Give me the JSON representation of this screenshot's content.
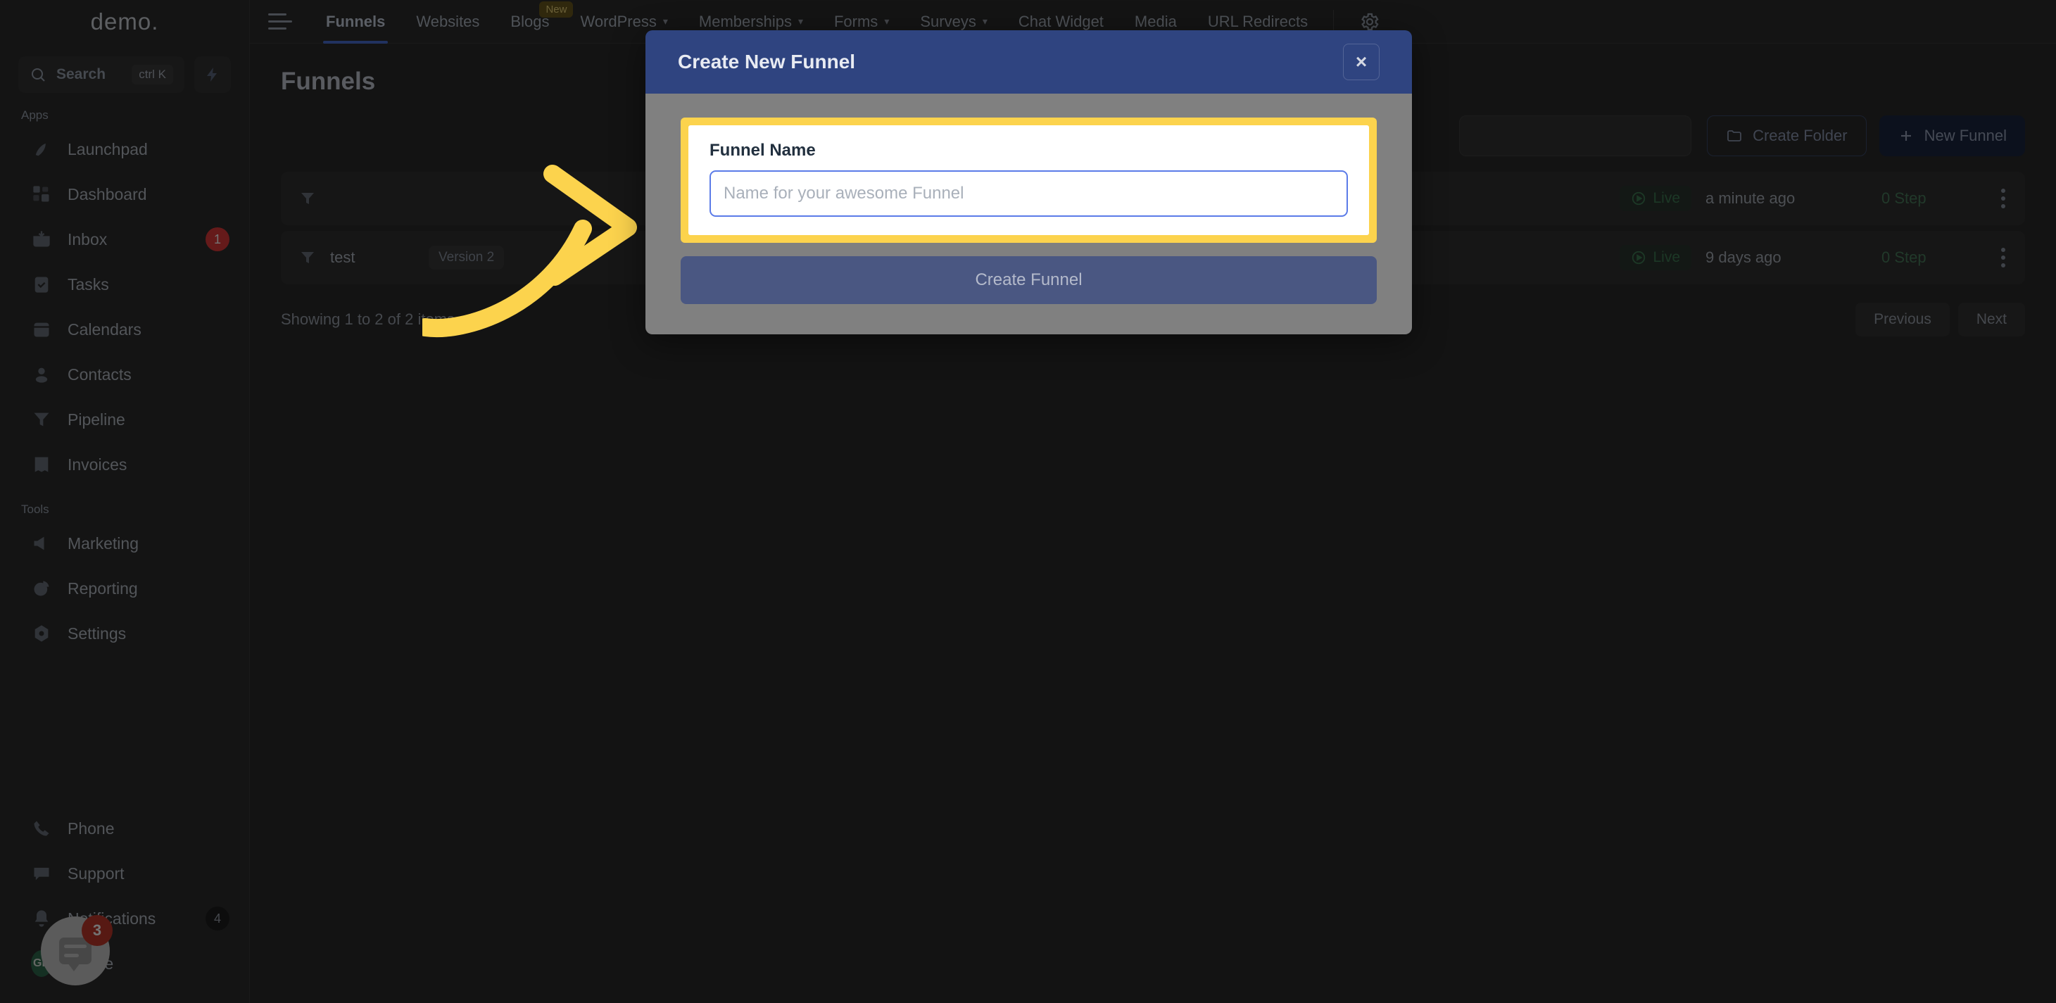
{
  "brand": {
    "logo": "demo."
  },
  "sidebar": {
    "search": {
      "label": "Search",
      "shortcut": "ctrl K"
    },
    "sections": [
      {
        "label": "Apps",
        "items": [
          {
            "label": "Launchpad",
            "icon": "rocket-icon",
            "badge": ""
          },
          {
            "label": "Dashboard",
            "icon": "grid-icon",
            "badge": ""
          },
          {
            "label": "Inbox",
            "icon": "inbox-icon",
            "badge": "1"
          },
          {
            "label": "Tasks",
            "icon": "clipboard-check-icon",
            "badge": ""
          },
          {
            "label": "Calendars",
            "icon": "calendar-icon",
            "badge": ""
          },
          {
            "label": "Contacts",
            "icon": "user-icon",
            "badge": ""
          },
          {
            "label": "Pipeline",
            "icon": "funnel-icon",
            "badge": ""
          },
          {
            "label": "Invoices",
            "icon": "invoice-icon",
            "badge": ""
          }
        ]
      },
      {
        "label": "Tools",
        "items": [
          {
            "label": "Marketing",
            "icon": "megaphone-icon",
            "badge": ""
          },
          {
            "label": "Reporting",
            "icon": "pie-chart-icon",
            "badge": ""
          },
          {
            "label": "Settings",
            "icon": "gear-icon",
            "badge": ""
          }
        ]
      }
    ],
    "bottom_items": [
      {
        "label": "Phone",
        "icon": "phone-icon",
        "badge": ""
      },
      {
        "label": "Support",
        "icon": "chat-icon",
        "badge": ""
      },
      {
        "label": "Notifications",
        "icon": "bell-icon",
        "badge": "4"
      },
      {
        "label": "Profile",
        "icon": "avatar-icon",
        "badge": "",
        "avatar": "GR"
      }
    ]
  },
  "topnav": {
    "items": [
      {
        "label": "Funnels",
        "active": true,
        "caret": false,
        "badge": ""
      },
      {
        "label": "Websites",
        "active": false,
        "caret": false,
        "badge": ""
      },
      {
        "label": "Blogs",
        "active": false,
        "caret": false,
        "badge": "New"
      },
      {
        "label": "WordPress",
        "active": false,
        "caret": true,
        "badge": ""
      },
      {
        "label": "Memberships",
        "active": false,
        "caret": true,
        "badge": ""
      },
      {
        "label": "Forms",
        "active": false,
        "caret": true,
        "badge": ""
      },
      {
        "label": "Surveys",
        "active": false,
        "caret": true,
        "badge": ""
      },
      {
        "label": "Chat Widget",
        "active": false,
        "caret": false,
        "badge": ""
      },
      {
        "label": "Media",
        "active": false,
        "caret": false,
        "badge": ""
      },
      {
        "label": "URL Redirects",
        "active": false,
        "caret": false,
        "badge": ""
      }
    ],
    "settings_icon": "gear-icon"
  },
  "main": {
    "title": "Funnels",
    "toolbar": {
      "filter_placeholder": "",
      "create_folder_label": "Create Folder",
      "new_funnel_label": "New Funnel"
    },
    "rows": [
      {
        "name": "",
        "version": "",
        "status": "Live",
        "updated": "a minute ago",
        "steps": "0 Step"
      },
      {
        "name": "test",
        "version": "Version 2",
        "status": "Live",
        "updated": "9 days ago",
        "steps": "0 Step"
      }
    ],
    "showing": "Showing 1 to 2 of 2 items",
    "pagination": {
      "previous": "Previous",
      "next": "Next"
    }
  },
  "chat_widget": {
    "badge": "3"
  },
  "modal": {
    "title": "Create New Funnel",
    "close_label": "×",
    "field_label": "Funnel Name",
    "field_value": "",
    "field_placeholder": "Name for your awesome Funnel",
    "submit_label": "Create Funnel"
  },
  "colors": {
    "modal_header": "#2f4480",
    "modal_body": "#808080",
    "highlight": "#fcd34d",
    "input_focus": "#5b7be8",
    "submit": "#4a5782",
    "accent": "#4a6fd4",
    "badge_red": "#c0392b",
    "live_green": "#3f7d55"
  }
}
